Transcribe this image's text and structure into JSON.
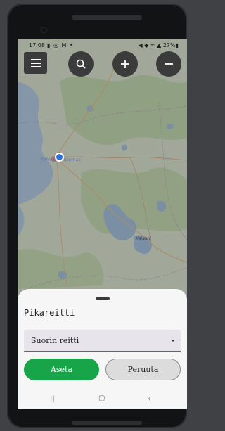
{
  "status_bar": {
    "time": "17.08",
    "left_icons": [
      "notification-icon",
      "whatsapp-icon",
      "gmail-icon",
      "dot-icon"
    ],
    "right_icons": [
      "mute-icon",
      "location-icon",
      "wifi-icon",
      "signal-icon"
    ],
    "battery": "27%"
  },
  "map": {
    "places": [
      "Pohjois-Pohjanmaa",
      "Kajaani"
    ]
  },
  "map_controls": {
    "menu": "menu-icon",
    "search": "search-icon",
    "zoom_in": "plus-icon",
    "zoom_out": "minus-icon"
  },
  "sheet": {
    "title": "Pikareitti",
    "select_value": "Suorin reitti",
    "primary_label": "Aseta",
    "secondary_label": "Peruuta"
  },
  "colors": {
    "primary": "#18a54a",
    "location_dot": "#2d6fd6",
    "control_bg": "#3b3b3b"
  }
}
